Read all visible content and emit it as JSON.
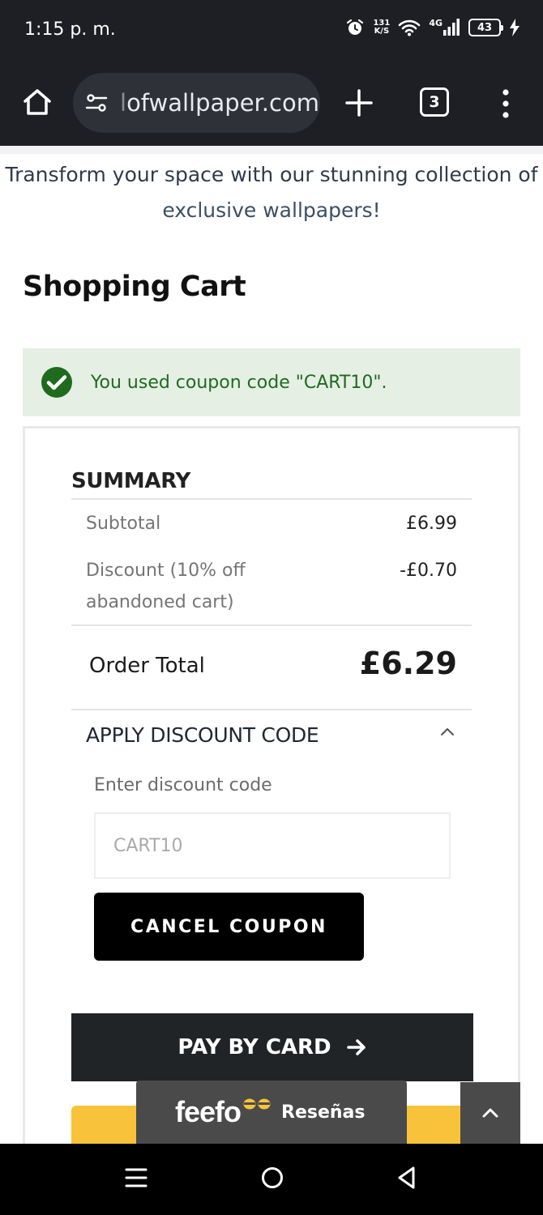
{
  "status_bar": {
    "time": "1:15 p. m.",
    "net_speed_top": "131",
    "net_speed_bottom": "K/S",
    "network": "4G",
    "battery": "43",
    "icons": [
      "alarm-icon",
      "wifi-icon",
      "signal-icon",
      "battery-icon",
      "charging-icon"
    ]
  },
  "browser": {
    "url_faded": "l",
    "url": "ofwallpaper.com",
    "tab_count": "3",
    "icons": [
      "home-icon",
      "site-settings-icon",
      "new-tab-icon",
      "tabs-icon",
      "menu-icon"
    ]
  },
  "page": {
    "tagline_line1": "Transform your space with our stunning collection of",
    "tagline_line2": "exclusive wallpapers!",
    "title": "Shopping Cart"
  },
  "alert": {
    "message": "You used coupon code \"CART10\".",
    "color": "#1f6b1d",
    "background": "#e5efe4"
  },
  "summary": {
    "heading": "SUMMARY",
    "rows": [
      {
        "label": "Subtotal",
        "value": "£6.99"
      },
      {
        "label_line1": "Discount (10% off",
        "label_line2": "abandoned cart)",
        "value": "-£0.70"
      }
    ],
    "total_label": "Order Total",
    "total_value": "£6.29"
  },
  "discount": {
    "header": "APPLY DISCOUNT CODE",
    "field_label": "Enter discount code",
    "input_value": "CART10",
    "cancel_button": "CANCEL COUPON"
  },
  "actions": {
    "pay_button": "PAY BY CARD",
    "yellow_button_color": "#f8c33a"
  },
  "feefo": {
    "logo": "feefo",
    "label": "Reseñas"
  },
  "nav": {
    "icons": [
      "recents-icon",
      "home-circle-icon",
      "back-icon"
    ]
  }
}
